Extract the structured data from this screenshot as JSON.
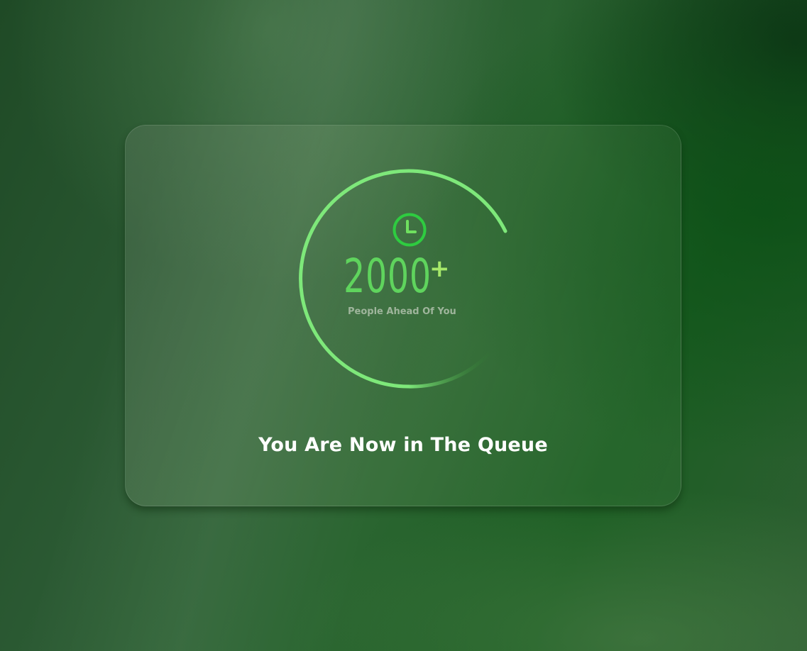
{
  "queue": {
    "count": "2000",
    "plus": "+",
    "subtitle": "People Ahead Of You",
    "heading": "You Are Now in The Queue"
  },
  "icons": {
    "clock": "clock-icon"
  },
  "colors": {
    "ring": "#7ee87a",
    "count": "#5fd45d",
    "plus": "#a6e86a",
    "clock": "#2ecc40",
    "heading": "#ffffff"
  }
}
